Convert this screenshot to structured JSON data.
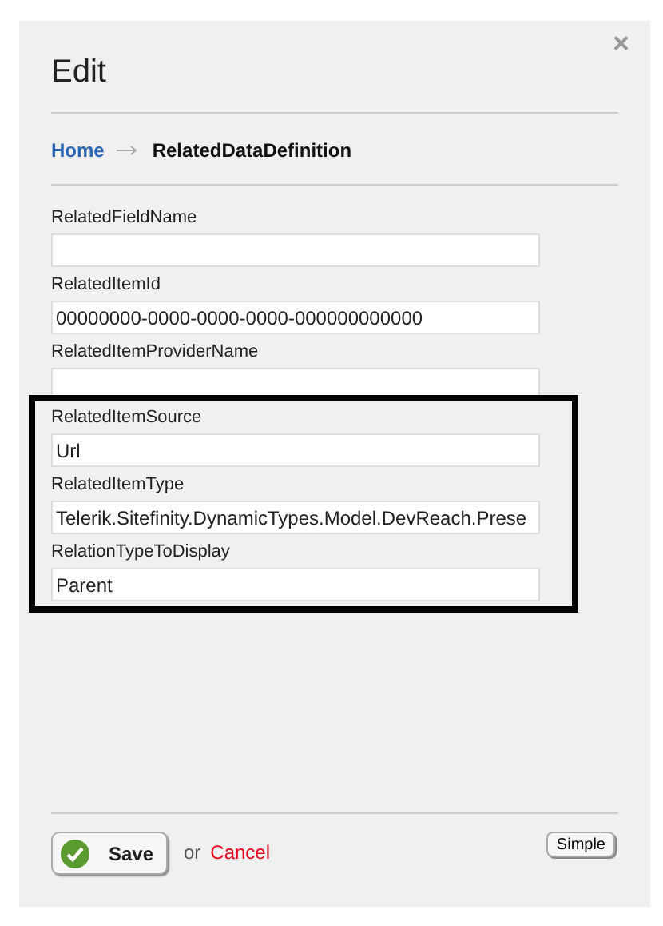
{
  "dialog": {
    "title": "Edit",
    "close": "×"
  },
  "breadcrumb": [
    {
      "label": "Home",
      "kind": "link"
    },
    {
      "label": "RelatedDataDefinition",
      "kind": "current"
    }
  ],
  "groups": [
    {
      "highlighted": false,
      "fields": [
        {
          "label": "RelatedFieldName"
        },
        {
          "label": "RelatedItemId",
          "value": "00000000-0000-0000-0000-000000000000"
        },
        {
          "label": "RelatedItemProviderName"
        }
      ]
    },
    {
      "highlighted": true,
      "fields": [
        {
          "label": "RelatedItemSource",
          "value": "Url"
        },
        {
          "label": "RelatedItemType",
          "value": "Telerik.Sitefinity.DynamicTypes.Model.DevReach.Prese"
        },
        {
          "label": "RelationTypeToDisplay",
          "value": "Parent"
        }
      ]
    }
  ],
  "footer": {
    "save": "Save",
    "or": "or",
    "cancel": "Cancel",
    "mode": "Simple"
  }
}
